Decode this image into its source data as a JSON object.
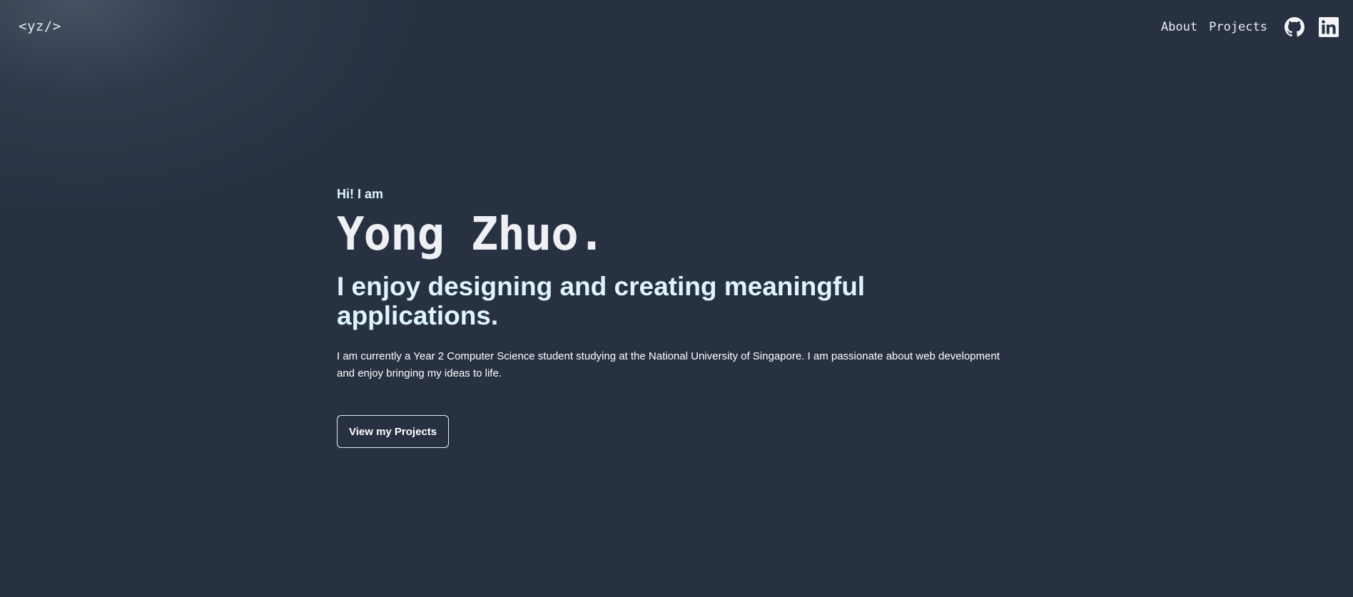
{
  "header": {
    "logo": "<yz/>",
    "nav": [
      {
        "label": "About"
      },
      {
        "label": "Projects"
      }
    ],
    "icons": [
      "github-icon",
      "linkedin-icon"
    ]
  },
  "hero": {
    "greeting": "Hi! I am",
    "name": "Yong Zhuo.",
    "tagline": "I enjoy designing and creating meaningful applications.",
    "description": "I am currently a Year 2 Computer Science student studying at the National University of Singapore. I am passionate about web development and enjoy bringing my ideas to life.",
    "cta_label": "View my Projects"
  },
  "colors": {
    "background": "#283142",
    "text": "#e9edf2",
    "accent": "#dff5fb"
  }
}
